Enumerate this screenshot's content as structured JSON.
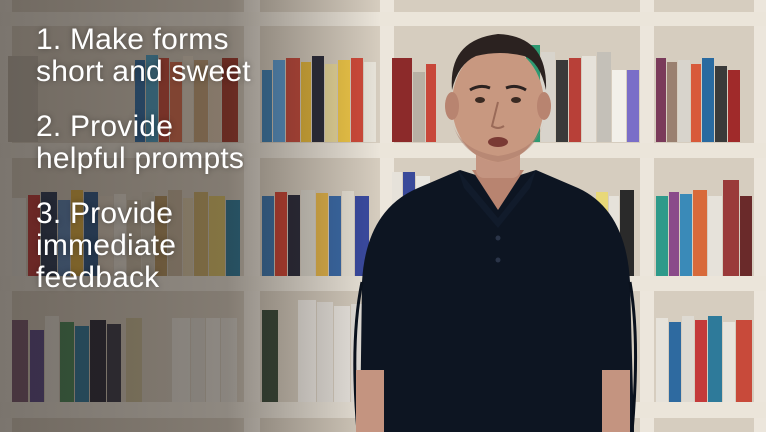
{
  "slide": {
    "bullets": [
      {
        "lines": [
          "1. Make forms",
          "short and sweet"
        ]
      },
      {
        "lines": [
          "2. Provide",
          "helpful prompts"
        ]
      },
      {
        "lines": [
          "3. Provide",
          "immediate",
          "feedback"
        ]
      }
    ]
  },
  "colors": {
    "text": "#ffffff",
    "shirt": "#0d1522",
    "skin": "#c89880",
    "hair": "#2b2220",
    "shelf_wood": "#e7e1d6"
  }
}
